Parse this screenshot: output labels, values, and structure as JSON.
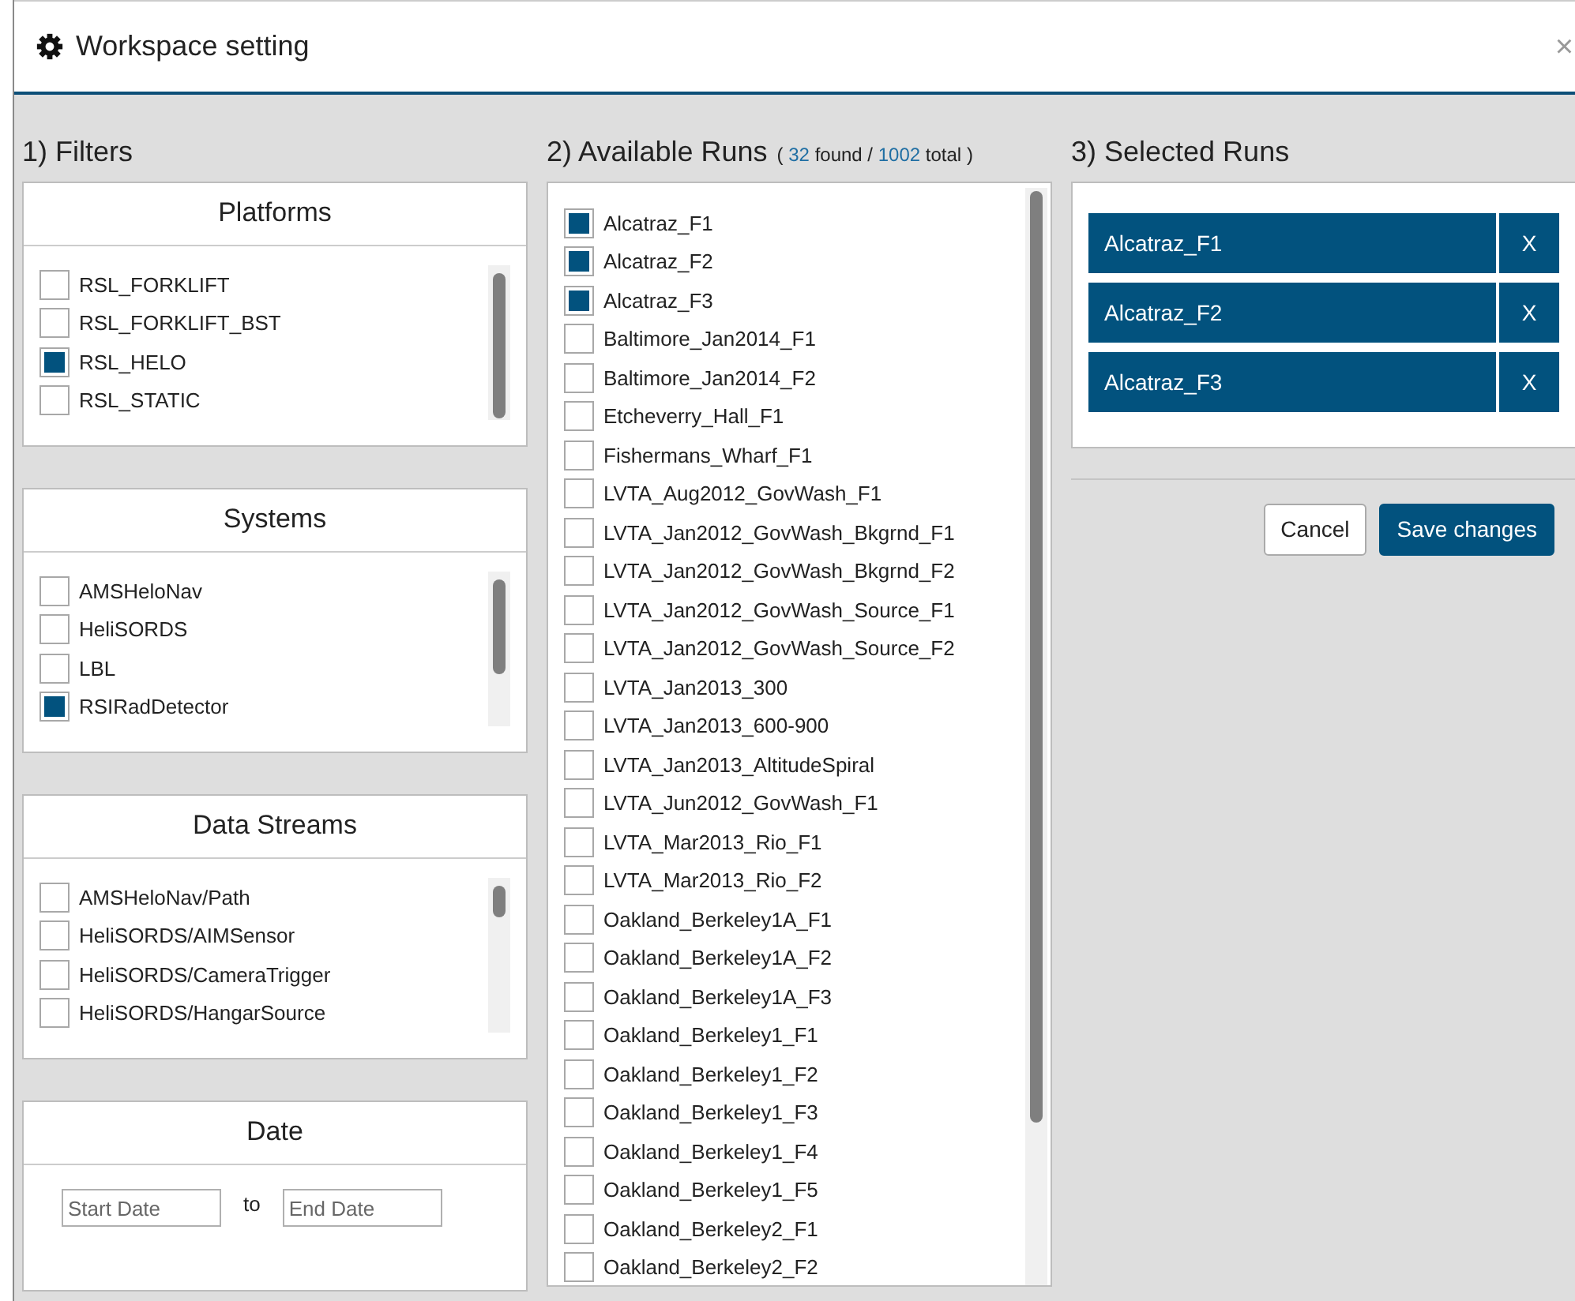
{
  "window": {
    "title": "Workspace setting",
    "close": "×"
  },
  "filters": {
    "heading": "1) Filters",
    "groups": [
      {
        "title": "Platforms",
        "items": [
          {
            "label": "RSL_FORKLIFT",
            "checked": false
          },
          {
            "label": "RSL_FORKLIFT_BST",
            "checked": false
          },
          {
            "label": "RSL_HELO",
            "checked": true
          },
          {
            "label": "RSL_STATIC",
            "checked": false
          }
        ]
      },
      {
        "title": "Systems",
        "items": [
          {
            "label": "AMSHeloNav",
            "checked": false
          },
          {
            "label": "HeliSORDS",
            "checked": false
          },
          {
            "label": "LBL",
            "checked": false
          },
          {
            "label": "RSIRadDetector",
            "checked": true
          }
        ]
      },
      {
        "title": "Data Streams",
        "items": [
          {
            "label": "AMSHeloNav/Path",
            "checked": false
          },
          {
            "label": "HeliSORDS/AIMSensor",
            "checked": false
          },
          {
            "label": "HeliSORDS/CameraTrigger",
            "checked": false
          },
          {
            "label": "HeliSORDS/HangarSource",
            "checked": false
          }
        ]
      }
    ],
    "date": {
      "title": "Date",
      "start": {
        "placeholder": "Start Date"
      },
      "separator": "to",
      "end": {
        "placeholder": "End Date"
      }
    }
  },
  "available": {
    "heading": "2) Available Runs",
    "count": [
      {
        "text": "(",
        "kind": "label"
      },
      {
        "text": "32",
        "kind": "number"
      },
      {
        "text": "found /",
        "kind": "label"
      },
      {
        "text": "1002",
        "kind": "number"
      },
      {
        "text": "total",
        "kind": "label"
      },
      {
        "text": ")",
        "kind": "label"
      }
    ],
    "runs": [
      {
        "label": "Alcatraz_F1",
        "checked": true
      },
      {
        "label": "Alcatraz_F2",
        "checked": true
      },
      {
        "label": "Alcatraz_F3",
        "checked": true
      },
      {
        "label": "Baltimore_Jan2014_F1",
        "checked": false
      },
      {
        "label": "Baltimore_Jan2014_F2",
        "checked": false
      },
      {
        "label": "Etcheverry_Hall_F1",
        "checked": false
      },
      {
        "label": "Fishermans_Wharf_F1",
        "checked": false
      },
      {
        "label": "LVTA_Aug2012_GovWash_F1",
        "checked": false
      },
      {
        "label": "LVTA_Jan2012_GovWash_Bkgrnd_F1",
        "checked": false
      },
      {
        "label": "LVTA_Jan2012_GovWash_Bkgrnd_F2",
        "checked": false
      },
      {
        "label": "LVTA_Jan2012_GovWash_Source_F1",
        "checked": false
      },
      {
        "label": "LVTA_Jan2012_GovWash_Source_F2",
        "checked": false
      },
      {
        "label": "LVTA_Jan2013_300",
        "checked": false
      },
      {
        "label": "LVTA_Jan2013_600-900",
        "checked": false
      },
      {
        "label": "LVTA_Jan2013_AltitudeSpiral",
        "checked": false
      },
      {
        "label": "LVTA_Jun2012_GovWash_F1",
        "checked": false
      },
      {
        "label": "LVTA_Mar2013_Rio_F1",
        "checked": false
      },
      {
        "label": "LVTA_Mar2013_Rio_F2",
        "checked": false
      },
      {
        "label": "Oakland_Berkeley1A_F1",
        "checked": false
      },
      {
        "label": "Oakland_Berkeley1A_F2",
        "checked": false
      },
      {
        "label": "Oakland_Berkeley1A_F3",
        "checked": false
      },
      {
        "label": "Oakland_Berkeley1_F1",
        "checked": false
      },
      {
        "label": "Oakland_Berkeley1_F2",
        "checked": false
      },
      {
        "label": "Oakland_Berkeley1_F3",
        "checked": false
      },
      {
        "label": "Oakland_Berkeley1_F4",
        "checked": false
      },
      {
        "label": "Oakland_Berkeley1_F5",
        "checked": false
      },
      {
        "label": "Oakland_Berkeley2_F1",
        "checked": false
      },
      {
        "label": "Oakland_Berkeley2_F2",
        "checked": false
      }
    ]
  },
  "selected": {
    "heading": "3) Selected Runs",
    "runs": [
      {
        "label": "Alcatraz_F1",
        "remove": "X"
      },
      {
        "label": "Alcatraz_F2",
        "remove": "X"
      },
      {
        "label": "Alcatraz_F3",
        "remove": "X"
      }
    ]
  },
  "buttons": [
    {
      "label": "Cancel",
      "kind": "secondary"
    },
    {
      "label": "Save changes",
      "kind": "primary"
    }
  ]
}
